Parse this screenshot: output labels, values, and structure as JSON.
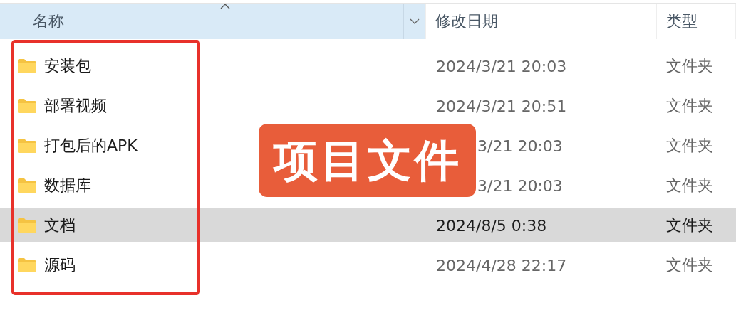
{
  "columns": [
    {
      "label": "名称",
      "sorted": true,
      "hovered": true
    },
    {
      "label": "修改日期",
      "sorted": false,
      "hovered": false
    },
    {
      "label": "类型",
      "sorted": false,
      "hovered": false
    }
  ],
  "rows": [
    {
      "name": "安装包",
      "modified": "2024/3/21 20:03",
      "type": "文件夹",
      "selected": false,
      "covered": false
    },
    {
      "name": "部署视频",
      "modified": "2024/3/21 20:51",
      "type": "文件夹",
      "selected": false,
      "covered": false
    },
    {
      "name": "打包后的APK",
      "modified": "3/21 20:03",
      "type": "文件夹",
      "selected": false,
      "covered": true
    },
    {
      "name": "数据库",
      "modified": "3/21 20:03",
      "type": "文件夹",
      "selected": false,
      "covered": true
    },
    {
      "name": "文档",
      "modified": "2024/8/5 0:38",
      "type": "文件夹",
      "selected": true,
      "covered": false
    },
    {
      "name": "源码",
      "modified": "2024/4/28 22:17",
      "type": "文件夹",
      "selected": false,
      "covered": false
    }
  ],
  "annotation": {
    "label": "项目文件"
  }
}
